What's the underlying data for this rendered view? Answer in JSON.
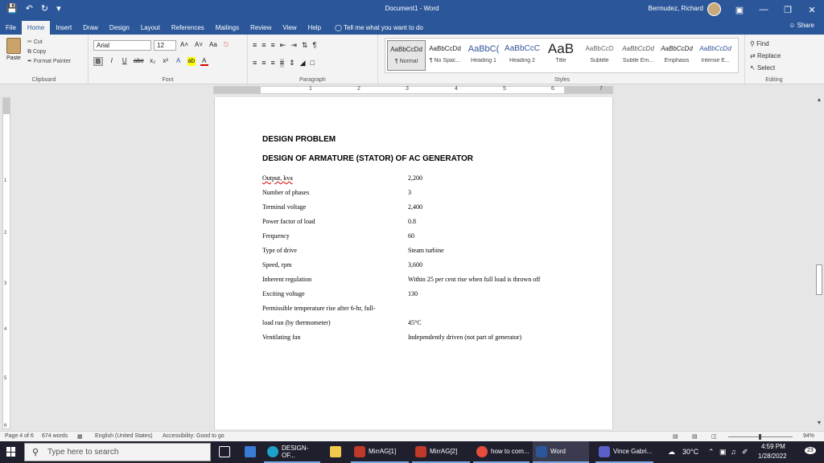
{
  "titlebar": {
    "document_title": "Document1  -  Word",
    "user_name": "Bermudez, Richard",
    "qat": [
      "save-icon",
      "undo-icon",
      "redo-icon",
      "customize-icon"
    ]
  },
  "tabs": {
    "items": [
      "File",
      "Home",
      "Insert",
      "Draw",
      "Design",
      "Layout",
      "References",
      "Mailings",
      "Review",
      "View",
      "Help"
    ],
    "active": "Home",
    "tell_me": "Tell me what you want to do",
    "share": "Share"
  },
  "ribbon": {
    "clipboard": {
      "paste": "Paste",
      "cut": "Cut",
      "copy": "Copy",
      "format_painter": "Format Painter",
      "label": "Clipboard"
    },
    "font": {
      "name": "Arial",
      "size": "12",
      "label": "Font",
      "bold": "B",
      "italic": "I",
      "underline": "U",
      "strike": "abc",
      "sub": "x₂",
      "sup": "x²",
      "grow": "A˄",
      "shrink": "A˅",
      "case": "Aa"
    },
    "paragraph": {
      "label": "Paragraph"
    },
    "styles": {
      "label": "Styles",
      "items": [
        {
          "sample": "AaBbCcDd",
          "name": "¶ Normal"
        },
        {
          "sample": "AaBbCcDd",
          "name": "¶ No Spac..."
        },
        {
          "sample": "AaBbC(",
          "name": "Heading 1"
        },
        {
          "sample": "AaBbCcC",
          "name": "Heading 2"
        },
        {
          "sample": "AaB",
          "name": "Title"
        },
        {
          "sample": "AaBbCcD",
          "name": "Subtitle"
        },
        {
          "sample": "AaBbCcDd",
          "name": "Subtle Em..."
        },
        {
          "sample": "AaBbCcDd",
          "name": "Emphasis"
        },
        {
          "sample": "AaBbCcDd",
          "name": "Intense E..."
        }
      ]
    },
    "editing": {
      "find": "Find",
      "replace": "Replace",
      "select": "Select",
      "label": "Editing"
    }
  },
  "document": {
    "heading1": "DESIGN PROBLEM",
    "heading2": "DESIGN OF ARMATURE (STATOR) OF AC GENERATOR",
    "specs": [
      {
        "label": "Output, kva",
        "value": "2,200"
      },
      {
        "label": "Number of phases",
        "value": "3"
      },
      {
        "label": "Terminal voltage",
        "value": "2,400"
      },
      {
        "label": "Power factor of load",
        "value": "0.8"
      },
      {
        "label": "Frequency",
        "value": "60"
      },
      {
        "label": "Type of drive",
        "value": "Steam turbine"
      },
      {
        "label": "Speed, rpm",
        "value": "3,600"
      },
      {
        "label": "Inherent regulation",
        "value": "Within 25 per cent rise when full load is thrown off"
      },
      {
        "label": "Exciting voltage",
        "value": "130"
      },
      {
        "label": "Permissible temperature rise after 6-hr, full-",
        "value": ""
      },
      {
        "label": "load run (by thermometer)",
        "value": "45°C"
      },
      {
        "label": "Ventilating fan",
        "value": "Independently driven (not part of generator)"
      }
    ]
  },
  "ruler": {
    "h_numbers": [
      "1",
      "2",
      "3",
      "4",
      "5",
      "6",
      "7"
    ],
    "v_numbers": [
      "1",
      "2",
      "3",
      "4",
      "5",
      "6"
    ]
  },
  "statusbar": {
    "page": "Page 4 of 6",
    "words": "674 words",
    "language": "English (United States)",
    "accessibility": "Accessibility: Good to go",
    "zoom": "94%"
  },
  "taskbar": {
    "search_placeholder": "Type here to search",
    "apps": [
      "DESIGN-OF...",
      "MirrAG[1]",
      "MirrAG[2]",
      "how to com...",
      "Word",
      "Vince Gabri..."
    ],
    "temperature": "30°C",
    "time": "4:59 PM",
    "date": "1/28/2022",
    "notifications": "23"
  },
  "colors": {
    "word_blue": "#2b579a",
    "taskbar": "#1f1f2e",
    "ribbon": "#f3f3f3"
  }
}
